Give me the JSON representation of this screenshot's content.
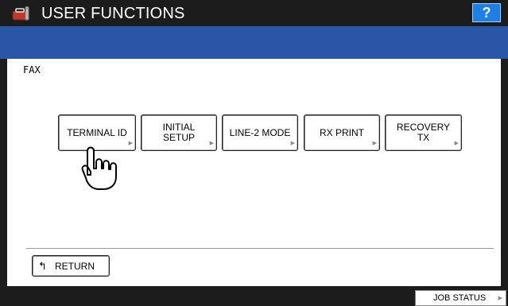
{
  "header": {
    "title": "USER FUNCTIONS",
    "help_label": "?",
    "icon": "toolbox-icon"
  },
  "breadcrumb": "FAX",
  "buttons": [
    {
      "label": "TERMINAL ID"
    },
    {
      "label": "INITIAL\nSETUP"
    },
    {
      "label": "LINE-2 MODE"
    },
    {
      "label": "RX PRINT"
    },
    {
      "label": "RECOVERY\nTX"
    }
  ],
  "return_label": "RETURN",
  "job_status_label": "JOB STATUS",
  "colors": {
    "title_bar": "#1c1c1c",
    "blue_bar": "#2b56a8",
    "help_button": "#1f7fe6"
  }
}
